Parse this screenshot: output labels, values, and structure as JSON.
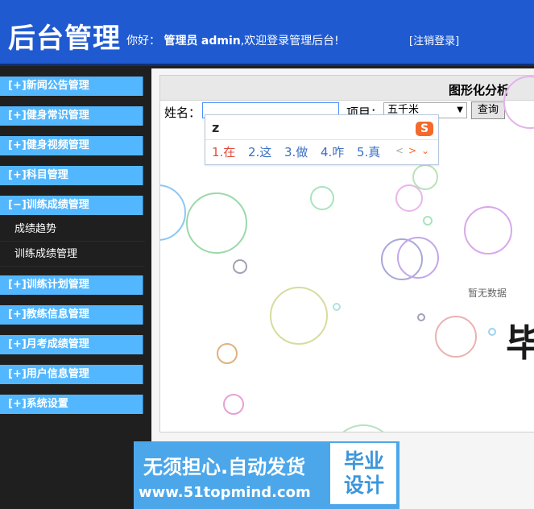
{
  "header": {
    "brand": "后台管理",
    "greeting": "你好：",
    "role": "管理员",
    "username": "admin",
    "welcome_text": ",欢迎登录管理后台!",
    "logout": "[注销登录]"
  },
  "sidebar": {
    "menu_items": [
      "[+]新闻公告管理",
      "[+]健身常识管理",
      "[+]健身视频管理",
      "[+]科目管理",
      "[−]训练成绩管理",
      "[+]训练计划管理",
      "[+]教练信息管理",
      "[+]月考成绩管理",
      "[+]用户信息管理",
      "[+]系统设置"
    ],
    "submenu_items": [
      "成绩趋势",
      "训练成绩管理"
    ]
  },
  "main": {
    "title": "图形化分析",
    "filters": {
      "name_label": "姓名：",
      "name_value": "",
      "project_label": "项目：",
      "project_value": "五千米",
      "query_button": "查询"
    },
    "empty_text": "暂无数据"
  },
  "ime": {
    "input": "z",
    "candidates": [
      "1.在",
      "2.这",
      "3.做",
      "4.咋",
      "5.真"
    ],
    "prev_icon": "chevron-left-icon",
    "next_icon": "chevron-right-icon",
    "expand_icon": "chevron-down-icon",
    "logo": "S"
  },
  "watermark": {
    "line1": "无须担心.自动发货",
    "line2": "www.51topmind.com",
    "badge_line1": "毕业",
    "badge_line2": "设计"
  },
  "right_glyph": "毕"
}
